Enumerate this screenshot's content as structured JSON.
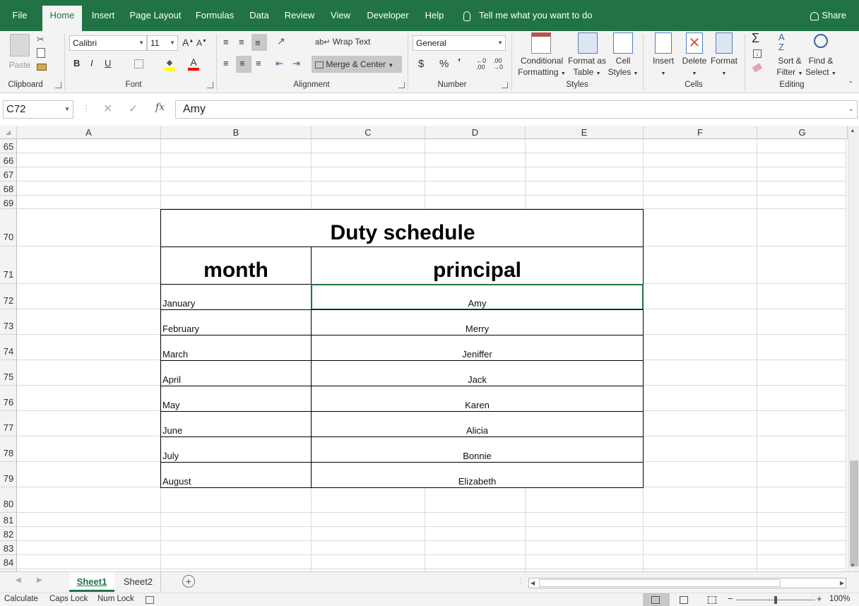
{
  "ribbon_tabs": [
    "File",
    "Home",
    "Insert",
    "Page Layout",
    "Formulas",
    "Data",
    "Review",
    "View",
    "Developer",
    "Help"
  ],
  "active_tab": "Home",
  "tell_me": "Tell me what you want to do",
  "share": "Share",
  "clipboard": {
    "paste": "Paste",
    "label": "Clipboard"
  },
  "font": {
    "name": "Calibri",
    "size": "11",
    "label": "Font",
    "bold": "B",
    "italic": "I",
    "underline": "U"
  },
  "alignment": {
    "wrap_text": "Wrap Text",
    "merge_center": "Merge & Center",
    "label": "Alignment"
  },
  "number": {
    "format": "General",
    "currency": "$",
    "percent": "%",
    "comma": "’",
    "label": "Number"
  },
  "styles": {
    "conditional": [
      "Conditional",
      "Formatting"
    ],
    "format_table": [
      "Format as",
      "Table"
    ],
    "cell_styles": [
      "Cell",
      "Styles"
    ],
    "label": "Styles"
  },
  "cells_group": {
    "insert": "Insert",
    "delete": "Delete",
    "format": "Format",
    "label": "Cells"
  },
  "editing": {
    "sort": [
      "Sort &",
      "Filter"
    ],
    "find": [
      "Find &",
      "Select"
    ],
    "label": "Editing"
  },
  "formula_bar": {
    "name_box": "C72",
    "fx": "fx",
    "content": "Amy"
  },
  "columns": [
    "A",
    "B",
    "C",
    "D",
    "E",
    "F",
    "G"
  ],
  "rows": [
    "65",
    "66",
    "67",
    "68",
    "69",
    "70",
    "71",
    "72",
    "73",
    "74",
    "75",
    "76",
    "77",
    "78",
    "79",
    "80",
    "81",
    "82",
    "83",
    "84"
  ],
  "table": {
    "title": "Duty schedule",
    "header_month": "month",
    "header_principal": "principal",
    "entries": [
      {
        "month": "January",
        "principal": "Amy"
      },
      {
        "month": "February",
        "principal": "Merry"
      },
      {
        "month": "March",
        "principal": "Jeniffer"
      },
      {
        "month": "April",
        "principal": "Jack"
      },
      {
        "month": "May",
        "principal": "Karen"
      },
      {
        "month": "June",
        "principal": "Alicia"
      },
      {
        "month": "July",
        "principal": "Bonnie"
      },
      {
        "month": "August",
        "principal": "Elizabeth"
      }
    ]
  },
  "sheets": [
    "Sheet1",
    "Sheet2"
  ],
  "active_sheet": "Sheet1",
  "status": {
    "calculate": "Calculate",
    "caps": "Caps Lock",
    "num": "Num Lock",
    "zoom": "100%"
  },
  "colors": {
    "accent": "#217346"
  }
}
